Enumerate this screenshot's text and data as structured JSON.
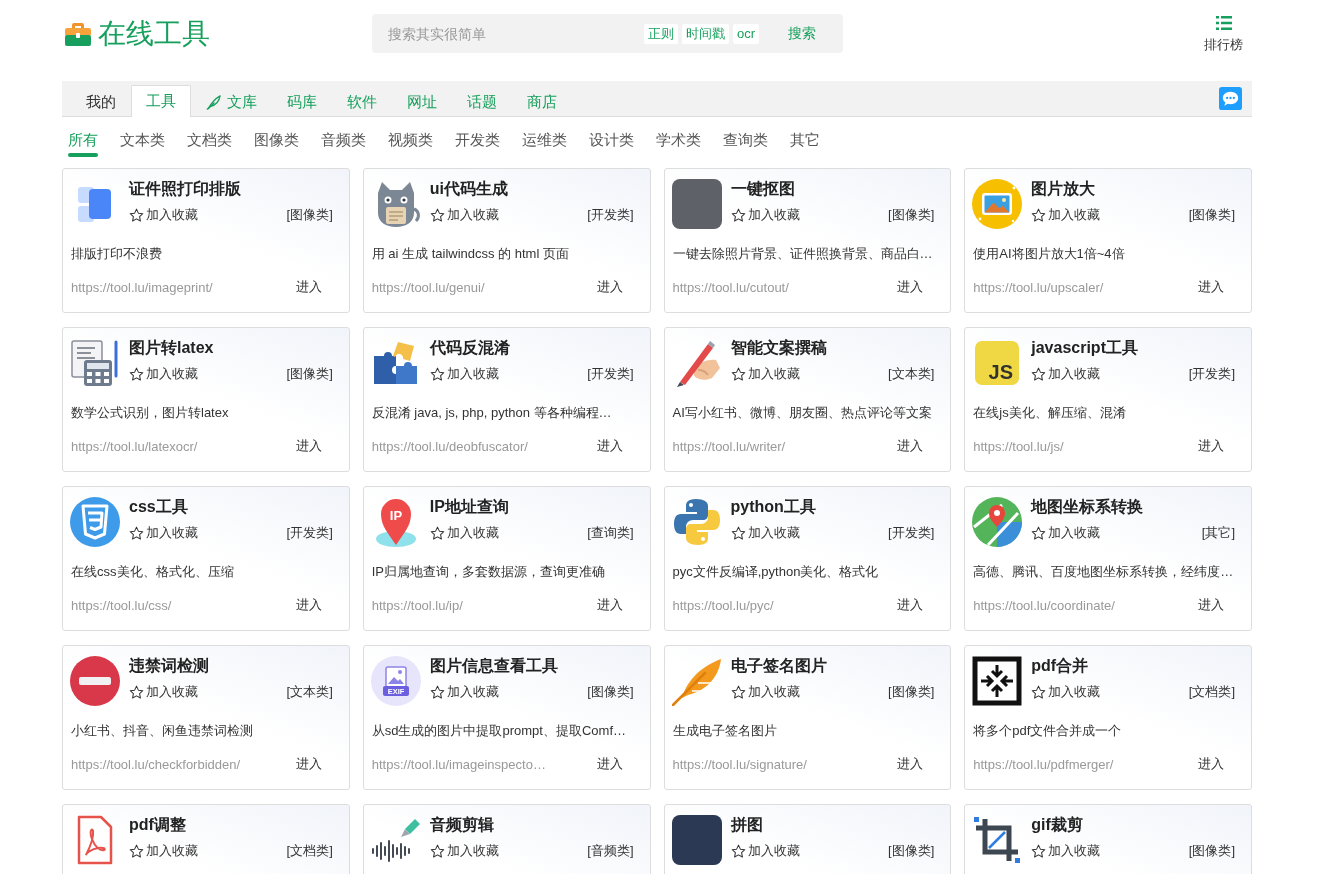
{
  "header": {
    "logo": "在线工具",
    "search": {
      "placeholder": "搜索其实很简单",
      "shortcuts": [
        "正则",
        "时间戳",
        "ocr"
      ],
      "button": "搜索"
    },
    "ranking": "排行榜"
  },
  "nav_tabs": [
    {
      "label": "我的",
      "kind": "personal",
      "has_icon": false,
      "selected": false
    },
    {
      "label": "工具",
      "kind": "section",
      "has_icon": false,
      "selected": true
    },
    {
      "label": "文库",
      "kind": "section",
      "has_icon": true,
      "selected": false
    },
    {
      "label": "码库",
      "kind": "section",
      "has_icon": false,
      "selected": false
    },
    {
      "label": "软件",
      "kind": "section",
      "has_icon": false,
      "selected": false
    },
    {
      "label": "网址",
      "kind": "section",
      "has_icon": false,
      "selected": false
    },
    {
      "label": "话题",
      "kind": "section",
      "has_icon": false,
      "selected": false
    },
    {
      "label": "商店",
      "kind": "section",
      "has_icon": false,
      "selected": false
    }
  ],
  "categories": [
    {
      "label": "所有",
      "selected": true
    },
    {
      "label": "文本类",
      "selected": false
    },
    {
      "label": "文档类",
      "selected": false
    },
    {
      "label": "图像类",
      "selected": false
    },
    {
      "label": "音频类",
      "selected": false
    },
    {
      "label": "视频类",
      "selected": false
    },
    {
      "label": "开发类",
      "selected": false
    },
    {
      "label": "运维类",
      "selected": false
    },
    {
      "label": "设计类",
      "selected": false
    },
    {
      "label": "学术类",
      "selected": false
    },
    {
      "label": "查询类",
      "selected": false
    },
    {
      "label": "其它",
      "selected": false
    }
  ],
  "tools": [
    {
      "title": "证件照打印排版",
      "favorite": "加入收藏",
      "category": "[图像类]",
      "description": "排版打印不浪费",
      "url": "https://tool.lu/imageprint/",
      "enter": "进入"
    },
    {
      "title": "ui代码生成",
      "favorite": "加入收藏",
      "category": "[开发类]",
      "description": "用 ai 生成 tailwindcss 的 html 页面",
      "url": "https://tool.lu/genui/",
      "enter": "进入"
    },
    {
      "title": "一键抠图",
      "favorite": "加入收藏",
      "category": "[图像类]",
      "description": "一键去除照片背景、证件照换背景、商品白…",
      "url": "https://tool.lu/cutout/",
      "enter": "进入"
    },
    {
      "title": "图片放大",
      "favorite": "加入收藏",
      "category": "[图像类]",
      "description": "使用AI将图片放大1倍~4倍",
      "url": "https://tool.lu/upscaler/",
      "enter": "进入"
    },
    {
      "title": "图片转latex",
      "favorite": "加入收藏",
      "category": "[图像类]",
      "description": "数学公式识别，图片转latex",
      "url": "https://tool.lu/latexocr/",
      "enter": "进入"
    },
    {
      "title": "代码反混淆",
      "favorite": "加入收藏",
      "category": "[开发类]",
      "description": "反混淆 java, js, php, python 等各种编程…",
      "url": "https://tool.lu/deobfuscator/",
      "enter": "进入"
    },
    {
      "title": "智能文案撰稿",
      "favorite": "加入收藏",
      "category": "[文本类]",
      "description": "AI写小红书、微博、朋友圈、热点评论等文案",
      "url": "https://tool.lu/writer/",
      "enter": "进入"
    },
    {
      "title": "javascript工具",
      "icon_text": "JS",
      "favorite": "加入收藏",
      "category": "[开发类]",
      "description": "在线js美化、解压缩、混淆",
      "url": "https://tool.lu/js/",
      "enter": "进入"
    },
    {
      "title": "css工具",
      "favorite": "加入收藏",
      "category": "[开发类]",
      "description": "在线css美化、格式化、压缩",
      "url": "https://tool.lu/css/",
      "enter": "进入"
    },
    {
      "title": "IP地址查询",
      "icon_text": "IP",
      "favorite": "加入收藏",
      "category": "[查询类]",
      "description": "IP归属地查询，多套数据源，查询更准确",
      "url": "https://tool.lu/ip/",
      "enter": "进入"
    },
    {
      "title": "python工具",
      "favorite": "加入收藏",
      "category": "[开发类]",
      "description": "pyc文件反编译,python美化、格式化",
      "url": "https://tool.lu/pyc/",
      "enter": "进入"
    },
    {
      "title": "地图坐标系转换",
      "favorite": "加入收藏",
      "category": "[其它]",
      "description": "高德、腾讯、百度地图坐标系转换，经纬度…",
      "url": "https://tool.lu/coordinate/",
      "enter": "进入"
    },
    {
      "title": "违禁词检测",
      "favorite": "加入收藏",
      "category": "[文本类]",
      "description": "小红书、抖音、闲鱼违禁词检测",
      "url": "https://tool.lu/checkforbidden/",
      "enter": "进入"
    },
    {
      "title": "图片信息查看工具",
      "icon_text": "EXIF",
      "favorite": "加入收藏",
      "category": "[图像类]",
      "description": "从sd生成的图片中提取prompt、提取Comf…",
      "url": "https://tool.lu/imageinspecto…",
      "enter": "进入"
    },
    {
      "title": "电子签名图片",
      "favorite": "加入收藏",
      "category": "[图像类]",
      "description": "生成电子签名图片",
      "url": "https://tool.lu/signature/",
      "enter": "进入"
    },
    {
      "title": "pdf合并",
      "favorite": "加入收藏",
      "category": "[文档类]",
      "description": "将多个pdf文件合并成一个",
      "url": "https://tool.lu/pdfmerger/",
      "enter": "进入"
    },
    {
      "title": "pdf调整",
      "favorite": "加入收藏",
      "category": "[文档类]"
    },
    {
      "title": "音频剪辑",
      "favorite": "加入收藏",
      "category": "[音频类]"
    },
    {
      "title": "拼图",
      "favorite": "加入收藏",
      "category": "[图像类]"
    },
    {
      "title": "gif裁剪",
      "favorite": "加入收藏",
      "category": "[图像类]"
    }
  ]
}
